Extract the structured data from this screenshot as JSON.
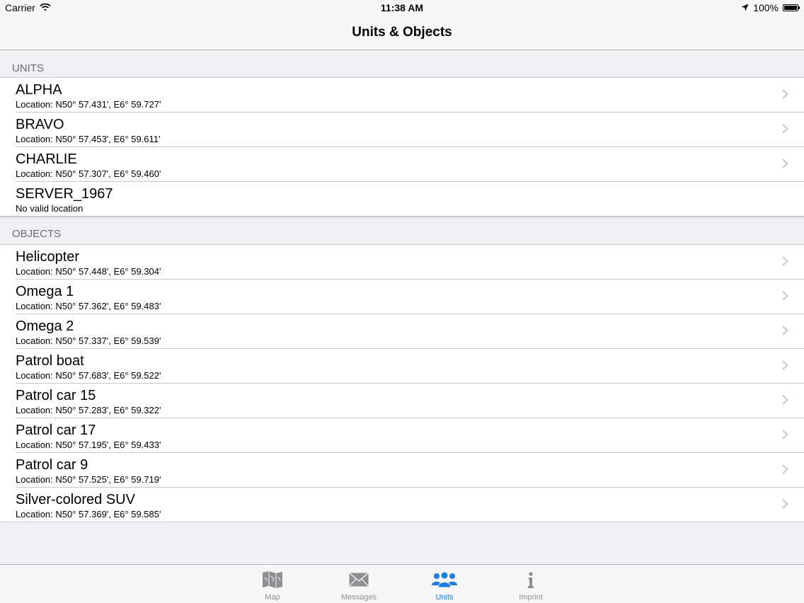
{
  "status_bar": {
    "carrier": "Carrier",
    "time": "11:38 AM",
    "battery": "100%"
  },
  "nav": {
    "title": "Units & Objects"
  },
  "sections": {
    "units": {
      "header": "UNITS",
      "rows": [
        {
          "title": "ALPHA",
          "subtitle": "Location: N50° 57.431', E6° 59.727'"
        },
        {
          "title": "BRAVO",
          "subtitle": "Location: N50° 57.453', E6° 59.611'"
        },
        {
          "title": "CHARLIE",
          "subtitle": "Location: N50° 57.307', E6° 59.460'"
        },
        {
          "title": "SERVER_1967",
          "subtitle": "No valid location"
        }
      ]
    },
    "objects": {
      "header": "OBJECTS",
      "rows": [
        {
          "title": "Helicopter",
          "subtitle": "Location: N50° 57.448', E6° 59.304'"
        },
        {
          "title": "Omega 1",
          "subtitle": "Location: N50° 57.362', E6° 59.483'"
        },
        {
          "title": "Omega 2",
          "subtitle": "Location: N50° 57.337', E6° 59.539'"
        },
        {
          "title": "Patrol boat",
          "subtitle": "Location: N50° 57.683', E6° 59.522'"
        },
        {
          "title": "Patrol car 15",
          "subtitle": "Location: N50° 57.283', E6° 59.322'"
        },
        {
          "title": "Patrol car 17",
          "subtitle": "Location: N50° 57.195', E6° 59.433'"
        },
        {
          "title": "Patrol car 9",
          "subtitle": "Location: N50° 57.525', E6° 59.719'"
        },
        {
          "title": "Silver-colored SUV",
          "subtitle": "Location: N50° 57.369', E6° 59.585'"
        }
      ]
    }
  },
  "tabbar": {
    "tabs": [
      {
        "label": "Map",
        "icon": "map-icon"
      },
      {
        "label": "Messages",
        "icon": "envelope-icon"
      },
      {
        "label": "Units",
        "icon": "people-icon"
      },
      {
        "label": "Imprint",
        "icon": "info-icon"
      }
    ],
    "active_tab": "Units"
  },
  "colors": {
    "accent": "#1a7ce5",
    "background": "#efeff4",
    "separator": "#c8c7cc",
    "section_header_text": "#6d6d72",
    "inactive_tab": "#929292"
  }
}
